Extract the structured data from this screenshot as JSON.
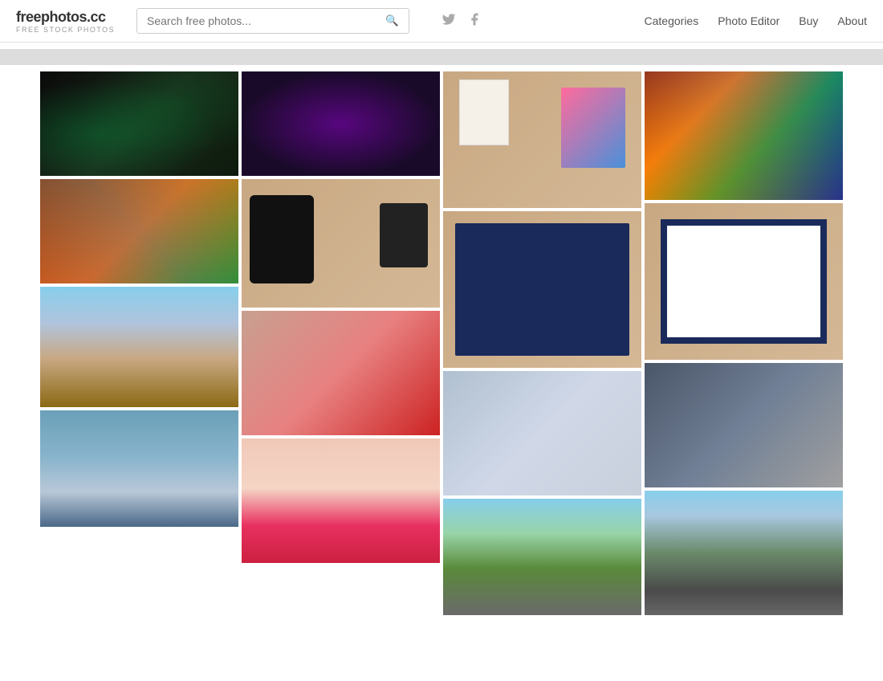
{
  "header": {
    "logo_main": "freephotos.cc",
    "logo_sub": "FREE STOCK PHOTOS",
    "search_placeholder": "Search free photos...",
    "social": {
      "twitter": "twitter-icon",
      "facebook": "facebook-icon"
    },
    "nav": {
      "categories": "Categories",
      "photo_editor": "Photo Editor",
      "buy": "Buy",
      "about": "About"
    }
  },
  "grid": {
    "columns": 4,
    "photos": [
      {
        "id": 1,
        "type": "dark-green",
        "col": 1
      },
      {
        "id": 2,
        "type": "purple-neon",
        "col": 2
      },
      {
        "id": 3,
        "type": "stationery",
        "col": 3
      },
      {
        "id": 4,
        "type": "painting",
        "col": 4
      },
      {
        "id": 5,
        "type": "art-brush",
        "col": 1
      },
      {
        "id": 6,
        "type": "gadgets",
        "col": 2
      },
      {
        "id": 7,
        "type": "frame-pink",
        "col": 3
      },
      {
        "id": 8,
        "type": "frame-white",
        "col": 4
      },
      {
        "id": 9,
        "type": "venice",
        "col": 1
      },
      {
        "id": 10,
        "type": "red-nails",
        "col": 2
      },
      {
        "id": 11,
        "type": "white-nails",
        "col": 3
      },
      {
        "id": 12,
        "type": "city-fist",
        "col": 4
      },
      {
        "id": 13,
        "type": "venice2",
        "col": 1
      },
      {
        "id": 14,
        "type": "red-lips",
        "col": 2
      },
      {
        "id": 15,
        "type": "mountain",
        "col": 3
      },
      {
        "id": 16,
        "type": "train",
        "col": 4
      }
    ]
  }
}
